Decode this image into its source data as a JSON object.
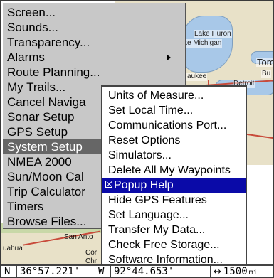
{
  "main_menu": {
    "items": [
      {
        "label": "Screen..."
      },
      {
        "label": "Sounds..."
      },
      {
        "label": "Transparency..."
      },
      {
        "label": "Alarms",
        "has_submenu": true
      },
      {
        "label": "Route Planning..."
      },
      {
        "label": "My Trails..."
      },
      {
        "label": "Cancel Naviga"
      },
      {
        "label": "Sonar Setup"
      },
      {
        "label": "GPS Setup"
      },
      {
        "label": "System Setup",
        "selected": true
      },
      {
        "label": "NMEA 2000"
      },
      {
        "label": "Sun/Moon Cal"
      },
      {
        "label": "Trip Calculator"
      },
      {
        "label": "Timers"
      },
      {
        "label": "Browse Files..."
      }
    ]
  },
  "sub_menu": {
    "items": [
      {
        "label": "Units of Measure..."
      },
      {
        "label": "Set Local Time..."
      },
      {
        "label": "Communications Port..."
      },
      {
        "label": "Reset Options"
      },
      {
        "label": "Simulators..."
      },
      {
        "label": "Delete All My Waypoints"
      },
      {
        "label": "Popup Help",
        "selected": true,
        "checked": true
      },
      {
        "label": "Hide GPS Features"
      },
      {
        "label": "Set Language..."
      },
      {
        "label": "Transfer My Data..."
      },
      {
        "label": "Check Free Storage..."
      },
      {
        "label": "Software Information..."
      }
    ]
  },
  "map": {
    "labels": {
      "lake_huron": "Lake Huron",
      "lake_michigan": "ke Michigan",
      "toro": "Toro",
      "bu": "Bu",
      "aukee": "aukee",
      "detroit": "Detroit",
      "san_anto": "San Anto",
      "uahua": "uahua",
      "cor": "Cor",
      "chr": "Chr"
    }
  },
  "status_bar": {
    "lat_hemisphere": "N",
    "latitude": "36°57.221'",
    "lon_hemisphere": "W",
    "longitude": "92°44.653'",
    "scale": "1500",
    "scale_unit": "mi"
  },
  "colors": {
    "menu_bg": "#c8c8c8",
    "menu_selected": "#666666",
    "submenu_selected": "#0a0aa8"
  }
}
